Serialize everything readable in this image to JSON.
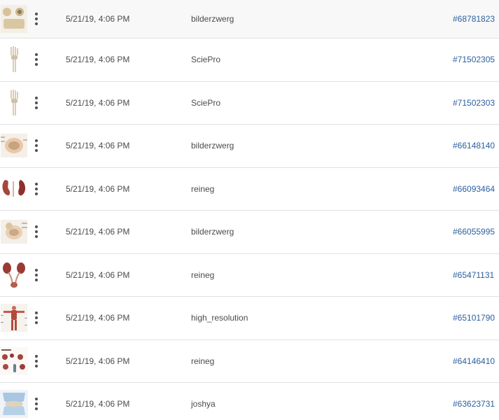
{
  "colors": {
    "link": "#2c5fa0",
    "text": "#4b4b4b",
    "divider": "#e1e1e1",
    "first_row_bg": "#f8f8f8"
  },
  "rows": [
    {
      "thumbnail_icon": "anatomy-knee-diagram-icon",
      "date": "5/21/19, 4:06 PM",
      "author": "bilderzwerg",
      "id": "#68781823"
    },
    {
      "thumbnail_icon": "hand-skeleton-icon",
      "date": "5/21/19, 4:06 PM",
      "author": "SciePro",
      "id": "#71502305"
    },
    {
      "thumbnail_icon": "hand-skeleton-icon",
      "date": "5/21/19, 4:06 PM",
      "author": "SciePro",
      "id": "#71502303"
    },
    {
      "thumbnail_icon": "brain-cross-section-icon",
      "date": "5/21/19, 4:06 PM",
      "author": "bilderzwerg",
      "id": "#66148140"
    },
    {
      "thumbnail_icon": "kidney-icon",
      "date": "5/21/19, 4:06 PM",
      "author": "reineg",
      "id": "#66093464"
    },
    {
      "thumbnail_icon": "brain-cross-section-icon",
      "date": "5/21/19, 4:06 PM",
      "author": "bilderzwerg",
      "id": "#66055995"
    },
    {
      "thumbnail_icon": "urinary-system-icon",
      "date": "5/21/19, 4:06 PM",
      "author": "reineg",
      "id": "#65471131"
    },
    {
      "thumbnail_icon": "human-muscle-chart-icon",
      "date": "5/21/19, 4:06 PM",
      "author": "high_resolution",
      "id": "#65101790"
    },
    {
      "thumbnail_icon": "kidney-infographic-icon",
      "date": "5/21/19, 4:06 PM",
      "author": "reineg",
      "id": "#64146410"
    },
    {
      "thumbnail_icon": "knee-joint-icon",
      "date": "5/21/19, 4:06 PM",
      "author": "joshya",
      "id": "#63623731"
    }
  ]
}
